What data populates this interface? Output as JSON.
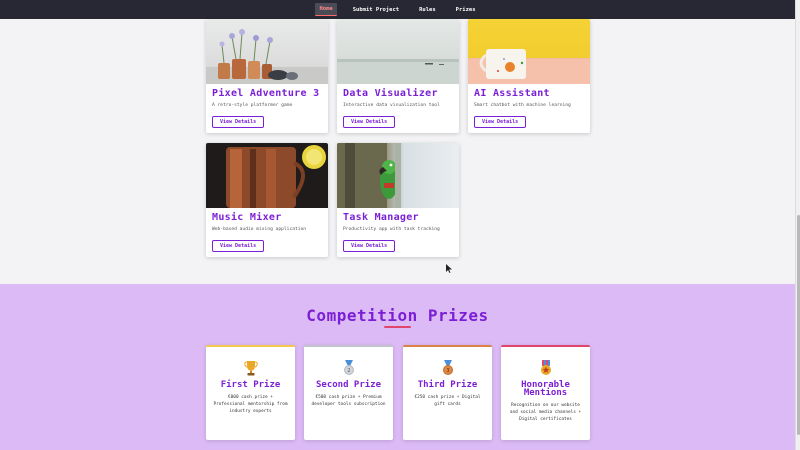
{
  "nav": {
    "items": [
      {
        "label": "Home",
        "active": true
      },
      {
        "label": "Submit Project",
        "active": false
      },
      {
        "label": "Rules",
        "active": false
      },
      {
        "label": "Prizes",
        "active": false
      }
    ]
  },
  "projects": [
    {
      "title": "Pixel Adventure 3",
      "description": "A retro-style platformer game",
      "button": "View Details",
      "image": "potted-flowers-photo"
    },
    {
      "title": "Data Visualizer",
      "description": "Interactive data visualization tool",
      "button": "View Details",
      "image": "foggy-lake-photo"
    },
    {
      "title": "AI Assistant",
      "description": "Smart chatbot with machine learning",
      "button": "View Details",
      "image": "mug-photo"
    },
    {
      "title": "Music Mixer",
      "description": "Web-based audio mixing application",
      "button": "View Details",
      "image": "copper-mug-drink-photo"
    },
    {
      "title": "Task Manager",
      "description": "Productivity app with task tracking",
      "button": "View Details",
      "image": "parrot-photo"
    }
  ],
  "prizes": {
    "title": "Competition Prizes",
    "items": [
      {
        "title": "First Prize",
        "description": "€000 cash prize + Professional mentorship from industry experts",
        "icon": "trophy-icon",
        "accent": "#f2c94c"
      },
      {
        "title": "Second Prize",
        "description": "€500 cash prize + Premium developer tools subscription",
        "icon": "silver-medal-icon",
        "accent": "#c0c4cc",
        "medal_number": "2"
      },
      {
        "title": "Third Prize",
        "description": "€250 cash prize + Digital gift cards",
        "icon": "bronze-medal-icon",
        "accent": "#d9824a",
        "medal_number": "3"
      },
      {
        "title": "Honorable Mentions",
        "description": "Recognition on our website and social media channels + Digital certificates",
        "icon": "star-medal-icon",
        "accent": "#e0456e"
      }
    ]
  }
}
